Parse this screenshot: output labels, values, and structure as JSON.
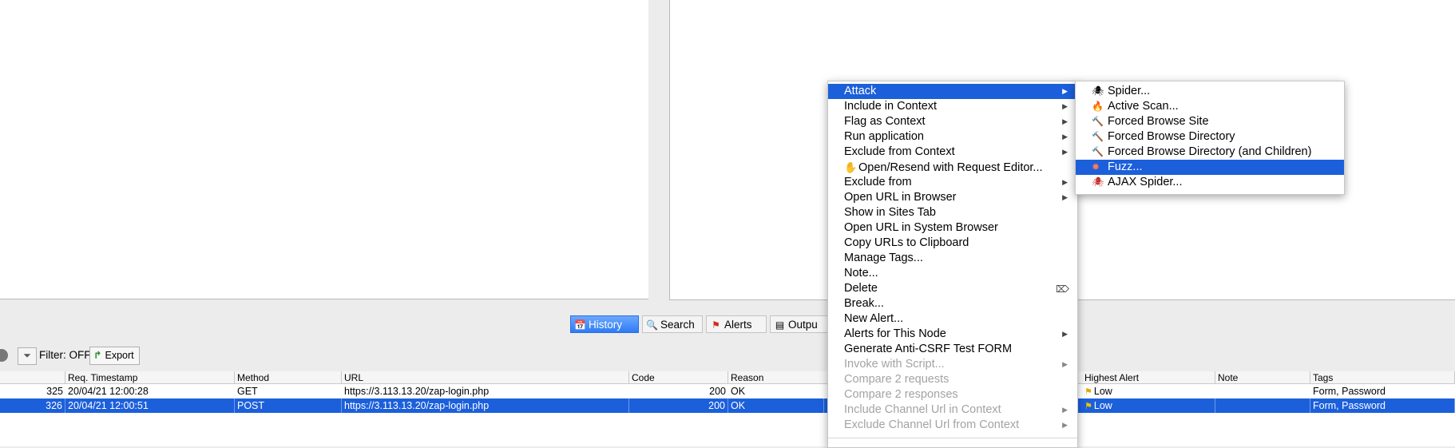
{
  "tabs": [
    {
      "icon": "history-icon",
      "glyph": "📅",
      "label": "History"
    },
    {
      "icon": "search-icon",
      "glyph": "🔍",
      "label": "Search"
    },
    {
      "icon": "alerts-flag-icon",
      "glyph": "⚑",
      "label": "Alerts"
    },
    {
      "icon": "output-icon",
      "glyph": "▤",
      "label": "Outpu"
    }
  ],
  "toolbar": {
    "filter_label": "Filter: OFF",
    "export_label": "Export"
  },
  "table": {
    "headers": [
      "Req. Timestamp",
      "Method",
      "URL",
      "Code",
      "Reason",
      "Highest Alert",
      "Note",
      "Tags"
    ],
    "rows": [
      {
        "id": "325",
        "timestamp": "20/04/21 12:00:28",
        "method": "GET",
        "url": "https://3.113.13.20/zap-login.php",
        "code": "200",
        "reason": "OK",
        "alert": "Low",
        "note": "",
        "tags": "Form, Password"
      },
      {
        "id": "326",
        "timestamp": "20/04/21 12:00:51",
        "method": "POST",
        "url": "https://3.113.13.20/zap-login.php",
        "code": "200",
        "reason": "OK",
        "alert": "Low",
        "note": "",
        "tags": "Form, Password"
      }
    ]
  },
  "context_menu": {
    "items": [
      {
        "label": "Attack",
        "submenu": true,
        "active": true
      },
      {
        "label": "Include in Context",
        "submenu": true
      },
      {
        "label": "Flag as Context",
        "submenu": true
      },
      {
        "label": "Run application",
        "submenu": true
      },
      {
        "label": "Exclude from Context",
        "submenu": true
      },
      {
        "label": "Open/Resend with Request Editor...",
        "icon": "hand-icon"
      },
      {
        "label": "Exclude from",
        "submenu": true
      },
      {
        "label": "Open URL in Browser",
        "submenu": true
      },
      {
        "label": "Show in Sites Tab"
      },
      {
        "label": "Open URL in System Browser"
      },
      {
        "label": "Copy URLs to Clipboard"
      },
      {
        "label": "Manage Tags..."
      },
      {
        "label": "Note..."
      },
      {
        "label": "Delete",
        "icon": "delete-key-icon"
      },
      {
        "label": "Break..."
      },
      {
        "label": "New Alert..."
      },
      {
        "label": "Alerts for This Node",
        "submenu": true
      },
      {
        "label": "Generate Anti-CSRF Test FORM"
      },
      {
        "label": "Invoke with Script...",
        "submenu": true,
        "disabled": true
      },
      {
        "label": "Compare 2 requests",
        "disabled": true
      },
      {
        "label": "Compare 2 responses",
        "disabled": true
      },
      {
        "label": "Include Channel Url in Context",
        "submenu": true,
        "disabled": true
      },
      {
        "label": "Exclude Channel Url from Context",
        "submenu": true,
        "disabled": true
      }
    ]
  },
  "attack_submenu": {
    "items": [
      {
        "label": "Spider...",
        "icon": "spider-icon",
        "glyph": "🕷"
      },
      {
        "label": "Active Scan...",
        "icon": "flame-icon",
        "glyph": "🔥"
      },
      {
        "label": "Forced Browse Site",
        "icon": "hammer-icon",
        "glyph": "🔨"
      },
      {
        "label": "Forced Browse Directory",
        "icon": "hammer-icon",
        "glyph": "🔨"
      },
      {
        "label": "Forced Browse Directory (and Children)",
        "icon": "hammer-icon",
        "glyph": "🔨"
      },
      {
        "label": "Fuzz...",
        "icon": "fuzz-icon",
        "glyph": "✹",
        "active": true
      },
      {
        "label": "AJAX Spider...",
        "icon": "ajax-spider-icon",
        "glyph": "🕷"
      }
    ]
  },
  "colors": {
    "selection": "#1c5fdb",
    "tab_active": "#2f7bf5",
    "disabled_text": "#a3a3a3"
  }
}
